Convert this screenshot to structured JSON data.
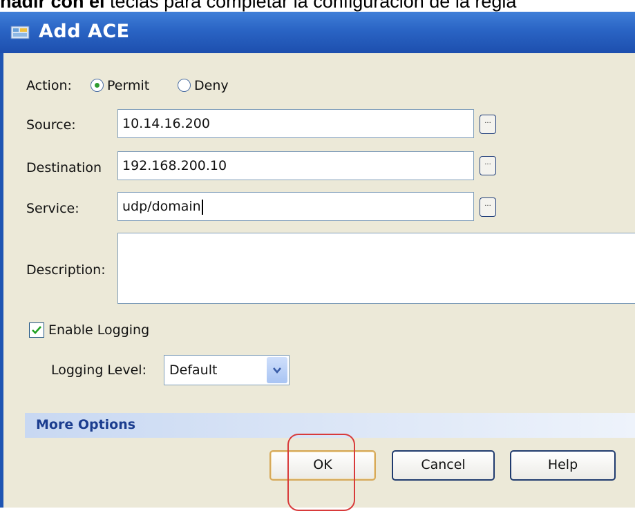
{
  "caption": {
    "bold_part": "ñadir con el",
    "rest": " teclas para completar la configuración de la regla"
  },
  "window": {
    "title": "Add ACE",
    "icon": "app-icon"
  },
  "action": {
    "label": "Action:",
    "options": [
      "Permit",
      "Deny"
    ],
    "selected": "Permit"
  },
  "source": {
    "label": "Source:",
    "value": "10.14.16.200",
    "browse": "..."
  },
  "destination": {
    "label": "Destination",
    "value": "192.168.200.10",
    "browse": "..."
  },
  "service": {
    "label": "Service:",
    "value": "udp/domain",
    "browse": "..."
  },
  "description": {
    "label": "Description:",
    "value": ""
  },
  "logging": {
    "enable_label": "Enable Logging",
    "enabled": true,
    "level_label": "Logging Level:",
    "level_value": "Default"
  },
  "more_options": {
    "label": "More Options"
  },
  "buttons": {
    "ok": "OK",
    "cancel": "Cancel",
    "help": "Help"
  },
  "colors": {
    "titlebar": "#2a64c4",
    "dialog_bg": "#ece9d8",
    "highlight": "#d83a3a"
  }
}
